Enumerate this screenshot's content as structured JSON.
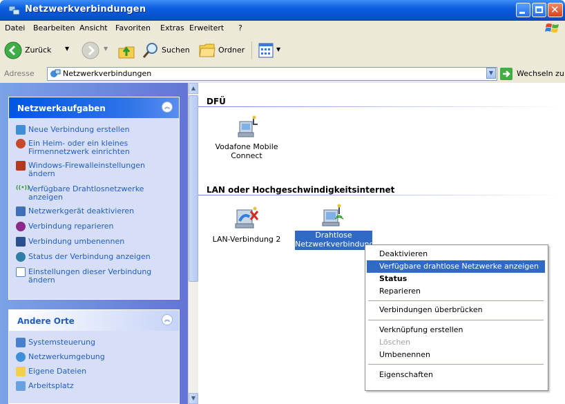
{
  "window": {
    "title": "Netzwerkverbindungen",
    "colors": {
      "titlebar": "#0a4fc8",
      "close": "#d9411e",
      "selection": "#316ac5",
      "link": "#215dc6"
    }
  },
  "menu": [
    "Datei",
    "Bearbeiten",
    "Ansicht",
    "Favoriten",
    "Extras",
    "Erweitert",
    "?"
  ],
  "toolbar": {
    "back": "Zurück",
    "search": "Suchen",
    "folders": "Ordner"
  },
  "address": {
    "label": "Adresse",
    "value": "Netzwerkverbindungen",
    "go": "Wechseln zu"
  },
  "left_pane": {
    "network_tasks": {
      "title": "Netzwerkaufgaben",
      "items": [
        {
          "label": "Neue Verbindung erstellen",
          "icon": "new-connection-icon"
        },
        {
          "label": "Ein Heim- oder ein kleines Firmennetzwerk einrichten",
          "icon": "home-network-icon"
        },
        {
          "label": "Windows-Firewalleinstellungen ändern",
          "icon": "firewall-icon"
        },
        {
          "label": "Verfügbare Drahtlosnetzwerke anzeigen",
          "icon": "wireless-signal-icon"
        },
        {
          "label": "Netzwerkgerät deaktivieren",
          "icon": "disable-device-icon"
        },
        {
          "label": "Verbindung reparieren",
          "icon": "repair-icon"
        },
        {
          "label": "Verbindung umbenennen",
          "icon": "rename-icon"
        },
        {
          "label": "Status der Verbindung anzeigen",
          "icon": "status-icon"
        },
        {
          "label": "Einstellungen dieser Verbindung ändern",
          "icon": "settings-icon"
        }
      ]
    },
    "other_places": {
      "title": "Andere Orte",
      "items": [
        {
          "label": "Systemsteuerung",
          "icon": "control-panel-icon"
        },
        {
          "label": "Netzwerkumgebung",
          "icon": "network-places-icon"
        },
        {
          "label": "Eigene Dateien",
          "icon": "my-documents-icon"
        },
        {
          "label": "Arbeitsplatz",
          "icon": "my-computer-icon"
        }
      ]
    }
  },
  "main": {
    "groups": [
      {
        "title": "DFÜ",
        "items": [
          {
            "label": "Vodafone Mobile Connect"
          }
        ]
      },
      {
        "title": "LAN oder Hochgeschwindigkeitsinternet",
        "items": [
          {
            "label": "LAN-Verbindung 2"
          },
          {
            "label": "Drahtlose Netzwerkverbindung",
            "selected": true
          }
        ]
      }
    ]
  },
  "context_menu": {
    "items": [
      {
        "label": "Deaktivieren"
      },
      {
        "label": "Verfügbare drahtlose Netzwerke anzeigen",
        "highlighted": true
      },
      {
        "label": "Status",
        "bold": true
      },
      {
        "label": "Reparieren"
      },
      {
        "separator": true
      },
      {
        "label": "Verbindungen überbrücken"
      },
      {
        "separator": true
      },
      {
        "label": "Verknüpfung erstellen"
      },
      {
        "label": "Löschen",
        "disabled": true
      },
      {
        "label": "Umbenennen"
      },
      {
        "separator": true
      },
      {
        "label": "Eigenschaften"
      }
    ]
  }
}
